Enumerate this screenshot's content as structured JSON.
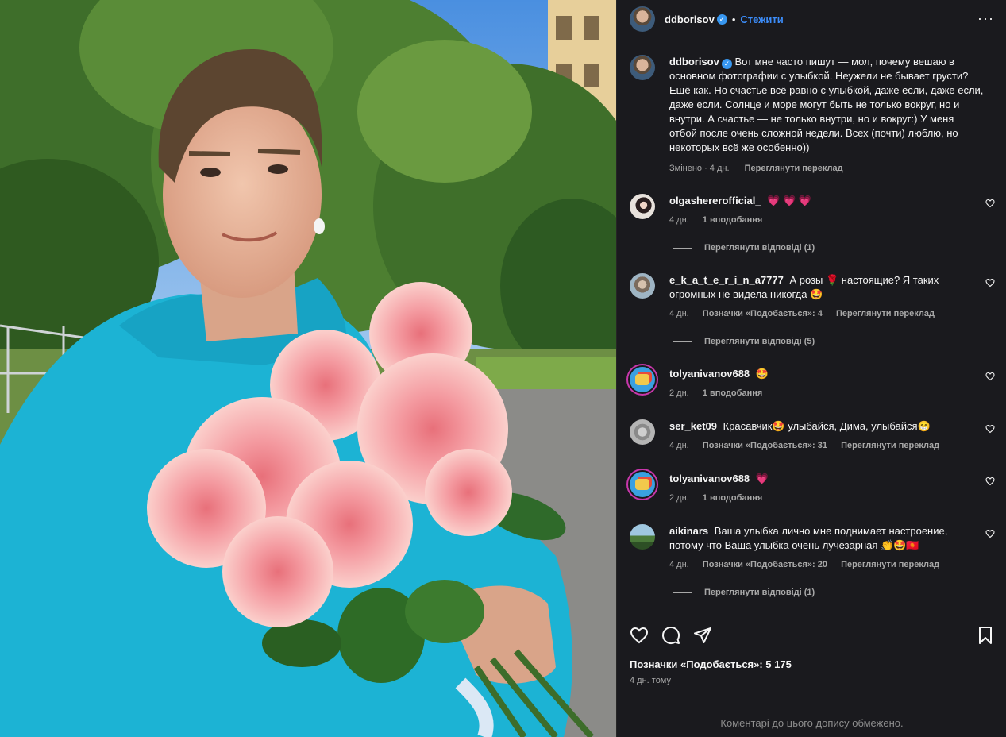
{
  "post": {
    "username": "ddborisov",
    "follow_label": "Стежити",
    "caption": "Вот мне часто пишут — мол, почему вешаю в основном фотографии с улыбкой. Неужели не бывает грусти? Ещё как. Но счастье всё равно с улыбкой, даже если, даже если, даже если. Солнце и море могут быть не только вокруг, но и внутри. А счастье — не только внутри, но и вокруг:) У меня отбой после очень сложной недели. Всех (почти) люблю, но некоторых всё же особенно))",
    "edited": "Змінено · 4 дн.",
    "translate": "Переглянути переклад"
  },
  "comments": [
    {
      "username": "olgashererofficial_",
      "text": "💗 💗 💗",
      "age": "4 дн.",
      "likes": "1 вподобання",
      "translate": "",
      "replies": "Переглянути відповіді (1)"
    },
    {
      "username": "e_k_a_t_e_r_i_n_a7777",
      "text": "А розы 🌹 настоящие? Я таких огромных не видела никогда 🤩",
      "age": "4 дн.",
      "likes": "Позначки «Подобається»: 4",
      "translate": "Переглянути переклад",
      "replies": "Переглянути відповіді (5)"
    },
    {
      "username": "tolyanivanov688",
      "text": "🤩",
      "age": "2 дн.",
      "likes": "1 вподобання",
      "translate": "",
      "replies": ""
    },
    {
      "username": "ser_ket09",
      "text": "Красавчик🤩 улыбайся, Дима, улыбайся😁",
      "age": "4 дн.",
      "likes": "Позначки «Подобається»: 31",
      "translate": "Переглянути переклад",
      "replies": ""
    },
    {
      "username": "tolyanivanov688",
      "text": "💗",
      "age": "2 дн.",
      "likes": "1 вподобання",
      "translate": "",
      "replies": ""
    },
    {
      "username": "aikinars",
      "text": "Ваша улыбка лично мне поднимает настроение, потому что Ваша улыбка очень лучезарная 👏🤩🇰🇬",
      "age": "4 дн.",
      "likes": "Позначки «Подобається»: 20",
      "translate": "Переглянути переклад",
      "replies": "Переглянути відповіді (1)"
    }
  ],
  "footer": {
    "likes": "Позначки «Подобається»: 5 175",
    "time": "4 дн. тому",
    "comments_limited": "Коментарі до цього допису обмежено."
  },
  "icons": {
    "more": "more-icon",
    "like": "heart-icon",
    "comment": "comment-icon",
    "share": "send-icon",
    "save": "bookmark-icon"
  },
  "colors": {
    "panel_bg": "#1a1a1e",
    "follow": "#3c8dfa",
    "verified": "#3897f0",
    "muted": "#a8a8a8"
  }
}
